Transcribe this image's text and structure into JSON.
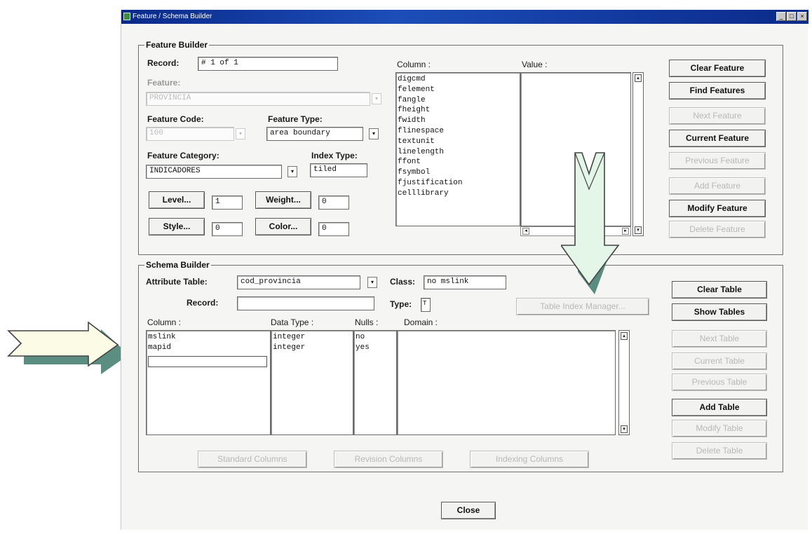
{
  "window": {
    "title": "Feature / Schema Builder",
    "controls": [
      "_",
      "□",
      "×"
    ]
  },
  "feature_builder": {
    "legend": "Feature Builder",
    "record_label": "Record:",
    "record_value": "# 1 of 1",
    "feature_label": "Feature:",
    "feature_value": "PROVINCIA",
    "feature_code_label": "Feature Code:",
    "feature_code_value": "100",
    "feature_type_label": "Feature Type:",
    "feature_type_value": "area boundary",
    "feature_category_label": "Feature Category:",
    "feature_category_value": "INDICADORES",
    "index_type_label": "Index Type:",
    "index_type_value": "tiled",
    "level_button": "Level...",
    "level_value": "1",
    "weight_button": "Weight...",
    "weight_value": "0",
    "style_button": "Style...",
    "style_value": "0",
    "color_button": "Color...",
    "color_value": "0",
    "column_header": "Column :",
    "value_header": "Value :",
    "columns": [
      "digcmd",
      "felement",
      "fangle",
      "fheight",
      "fwidth",
      "flinespace",
      "textunit",
      "linelength",
      "ffont",
      "fsymbol",
      "fjustification",
      "celllibrary"
    ],
    "buttons": {
      "clear_feature": "Clear Feature",
      "find_features": "Find Features",
      "next_feature": "Next Feature",
      "current_feature": "Current Feature",
      "previous_feature": "Previous Feature",
      "add_feature": "Add Feature",
      "modify_feature": "Modify Feature",
      "delete_feature": "Delete Feature"
    }
  },
  "schema_builder": {
    "legend": "Schema Builder",
    "attribute_table_label": "Attribute Table:",
    "attribute_table_value": "cod_provincia",
    "class_label": "Class:",
    "class_value": "no mslink",
    "record_label": "Record:",
    "record_value": "",
    "type_label": "Type:",
    "type_value": "T",
    "table_index_manager": "Table Index Manager...",
    "headers": {
      "column": "Column :",
      "data_type": "Data Type :",
      "nulls": "Nulls :",
      "domain": "Domain :"
    },
    "rows": [
      {
        "column": "mslink",
        "data_type": "integer",
        "nulls": "no"
      },
      {
        "column": "mapid",
        "data_type": "integer",
        "nulls": "yes"
      }
    ],
    "bottom_buttons": {
      "standard_columns": "Standard Columns",
      "revision_columns": "Revision Columns",
      "indexing_columns": "Indexing Columns"
    },
    "buttons": {
      "clear_table": "Clear Table",
      "show_tables": "Show Tables",
      "next_table": "Next Table",
      "current_table": "Current Table",
      "previous_table": "Previous Table",
      "add_table": "Add Table",
      "modify_table": "Modify Table",
      "delete_table": "Delete Table"
    }
  },
  "close_button": "Close",
  "annotations": {
    "arrow_fill": "#fbfbe6",
    "arrow_shadow": "#3e7a6a",
    "down_arrow_fill": "#e4f6e8"
  }
}
